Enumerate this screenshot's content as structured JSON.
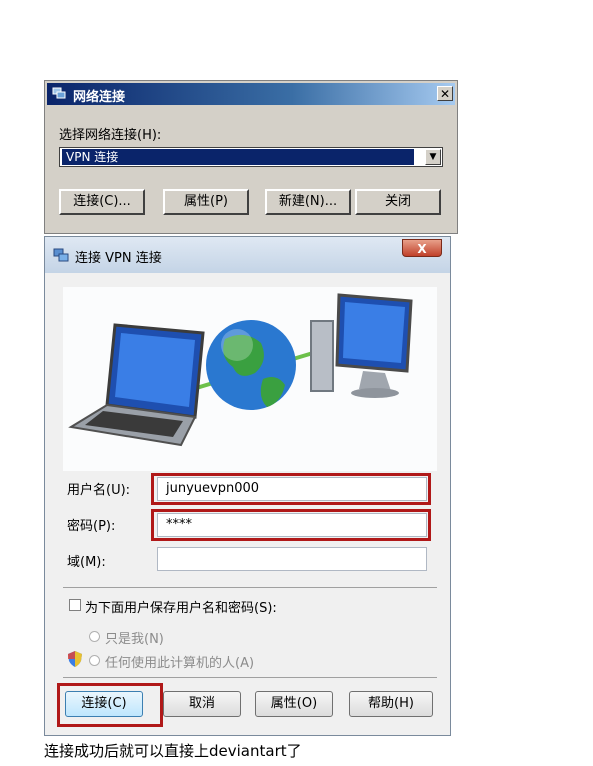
{
  "network_dialog": {
    "title": "网络连接",
    "select_label": "选择网络连接(H):",
    "selected_connection": "VPN 连接",
    "buttons": {
      "connect": "连接(C)...",
      "properties": "属性(P)",
      "new": "新建(N)...",
      "close": "关闭"
    }
  },
  "vpn_dialog": {
    "title": "连接 VPN 连接",
    "username_label": "用户名(U):",
    "username_value": "junyuevpn000",
    "password_label": "密码(P):",
    "password_value": "****",
    "domain_label": "域(M):",
    "domain_value": "",
    "save_credentials_label": "为下面用户保存用户名和密码(S):",
    "option_me_only": "只是我(N)",
    "option_anyone": "任何使用此计算机的人(A)",
    "buttons": {
      "connect": "连接(C)",
      "cancel": "取消",
      "properties": "属性(O)",
      "help": "帮助(H)"
    }
  },
  "caption": "连接成功后就可以直接上deviantart了",
  "colors": {
    "highlight_red": "#b01818",
    "title_blue": "#0a246a"
  }
}
